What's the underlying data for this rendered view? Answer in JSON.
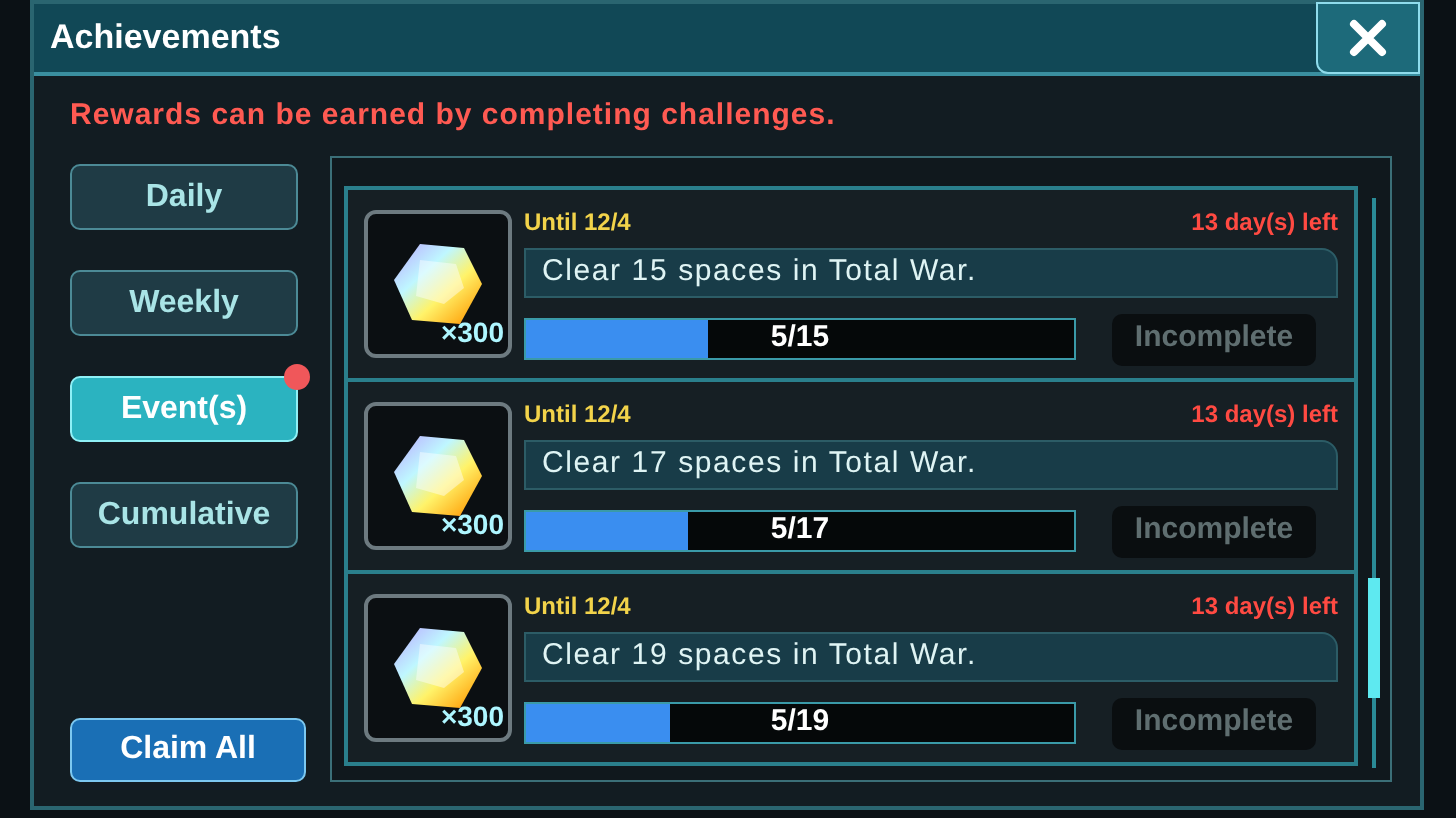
{
  "window": {
    "title": "Achievements"
  },
  "notice": "Rewards can be earned by completing challenges.",
  "tabs": [
    {
      "label": "Daily",
      "selected": false,
      "badge": false
    },
    {
      "label": "Weekly",
      "selected": false,
      "badge": false
    },
    {
      "label": "Event(s)",
      "selected": true,
      "badge": true
    },
    {
      "label": "Cumulative",
      "selected": false,
      "badge": false
    }
  ],
  "claim_all": "Claim All",
  "challenges": [
    {
      "until": "Until 12/4",
      "time_left": "13 day(s) left",
      "reward_count": "×300",
      "task": "Clear 15 spaces in Total War.",
      "level": 0.333,
      "progress": "5/15",
      "status": "Incomplete"
    },
    {
      "until": "Until 12/4",
      "time_left": "13 day(s) left",
      "reward_count": "×300",
      "task": "Clear 17 spaces in Total War.",
      "level": 0.294,
      "progress": "5/17",
      "status": "Incomplete"
    },
    {
      "until": "Until 12/4",
      "time_left": "13 day(s) left",
      "reward_count": "×300",
      "task": "Clear 19 spaces in Total War.",
      "level": 0.263,
      "progress": "5/19",
      "status": "Incomplete"
    }
  ]
}
